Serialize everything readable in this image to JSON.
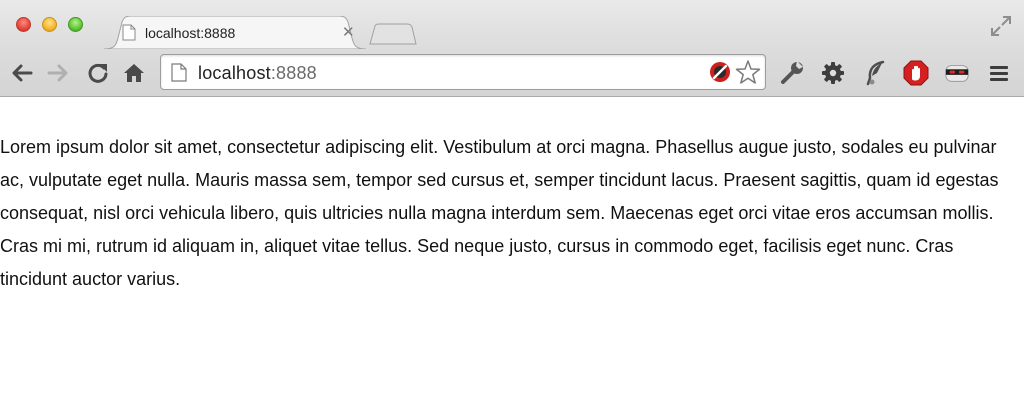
{
  "window": {
    "tab_title": "localhost:8888"
  },
  "toolbar": {
    "url_host": "localhost",
    "url_port": ":8888"
  },
  "icons": [
    "close-window-icon",
    "minimize-window-icon",
    "maximize-window-icon",
    "page-icon",
    "tab-close-icon",
    "new-tab-icon",
    "fullscreen-icon",
    "back-icon",
    "forward-icon",
    "reload-icon",
    "home-icon",
    "blocked-icon",
    "bookmark-star-icon",
    "wrench-icon",
    "gear-icon",
    "feather-icon",
    "stop-icon",
    "mask-icon",
    "menu-icon"
  ],
  "colors": {
    "stop_red": "#d42020",
    "blocked_red": "#cc1f1f"
  },
  "content": {
    "paragraph": "Lorem ipsum dolor sit amet, consectetur adipiscing elit. Vestibulum at orci magna. Phasellus augue justo, sodales eu pulvinar ac, vulputate eget nulla. Mauris massa sem, tempor sed cursus et, semper tincidunt lacus. Praesent sagittis, quam id egestas consequat, nisl orci vehicula libero, quis ultricies nulla magna interdum sem. Maecenas eget orci vitae eros accumsan mollis. Cras mi mi, rutrum id aliquam in, aliquet vitae tellus. Sed neque justo, cursus in commodo eget, facilisis eget nunc. Cras tincidunt auctor varius."
  }
}
